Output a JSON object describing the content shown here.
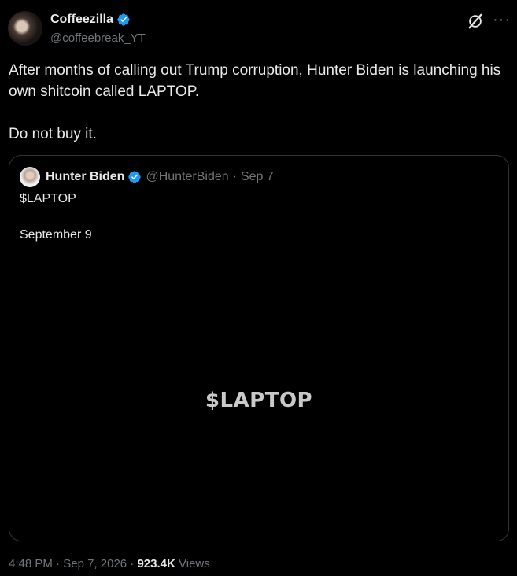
{
  "author": {
    "name": "Coffeezilla",
    "handle": "@coffeebreak_YT"
  },
  "tweet": {
    "line1": "After months of calling out Trump corruption, Hunter Biden is launching his own shitcoin called LAPTOP.",
    "line2": "Do not buy it."
  },
  "quote": {
    "author_name": "Hunter Biden",
    "author_handle": "@HunterBiden",
    "separator": "·",
    "date": "Sep 7",
    "text_line1": "$LAPTOP",
    "text_line2": "September 9",
    "media_text": "$LAPTOP"
  },
  "meta": {
    "time": "4:48 PM",
    "separator": "·",
    "date": "Sep 7, 2026",
    "views_count": "923.4K",
    "views_label": "Views"
  },
  "icons": {
    "verified": "verified-badge-icon",
    "grok": "grok-icon",
    "more": "more-icon"
  },
  "colors": {
    "background": "#000000",
    "text": "#e7e9ea",
    "muted": "#71767b",
    "verified": "#1d9bf0",
    "border": "#2f3336"
  }
}
